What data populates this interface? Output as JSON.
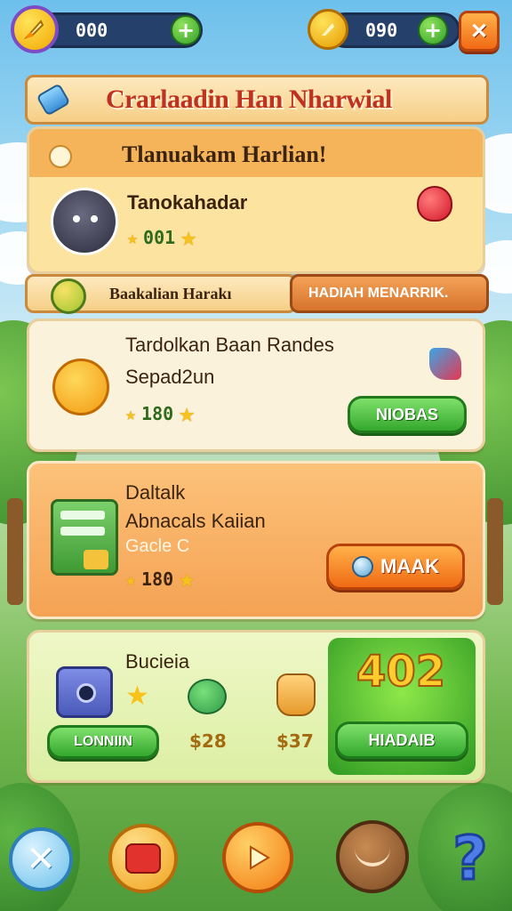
{
  "top_bar": {
    "currency_left": {
      "value": "000",
      "icon": "boost-icon"
    },
    "currency_right": {
      "value": "090",
      "icon": "coin-icon"
    },
    "add_label": "+",
    "close_label": "✕"
  },
  "main_banner": {
    "title": "Crarlaadin Han Nharwial"
  },
  "task_card": {
    "header": "Tlanuakam Harlian!",
    "item_name": "Tanokahadar",
    "points": "001"
  },
  "tabs": {
    "left": "Baakalian Harakı",
    "right": "HADIAH MENARRIK."
  },
  "mission_card": {
    "title": "Tardolkan Baan Randes",
    "subtitle": "Sepad2un",
    "points": "180",
    "button": "NIOBAS"
  },
  "orange_card": {
    "title": "Daltalk",
    "subtitle": "Abnacals Kaiian",
    "extra": "Gacle C",
    "points": "180",
    "button": "MAAK"
  },
  "shop_card": {
    "title": "Bucieia",
    "button_left": "LONNIIN",
    "price_1": "$28",
    "price_2": "$37",
    "big_number": "402",
    "button_right": "HIADAIB"
  },
  "colors": {
    "accent_orange": "#f06a14",
    "accent_green": "#34a82e",
    "title_red": "#c0311f"
  }
}
